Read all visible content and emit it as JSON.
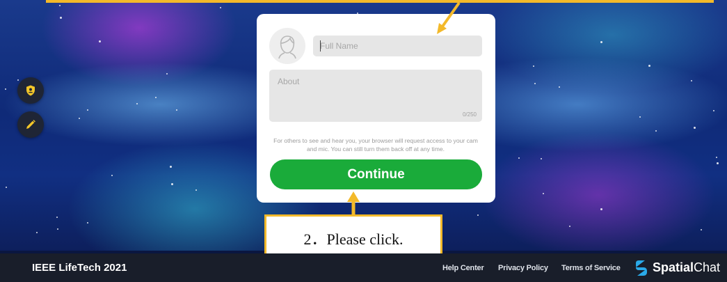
{
  "profile_form": {
    "name_placeholder": "Full Name",
    "about_placeholder": "About",
    "char_count": "0/250",
    "permission_notice": "For others to see and hear you, your browser will request access to your cam and mic. You can still turn them back off at any time.",
    "continue_label": "Continue"
  },
  "sidebar": {
    "items": [
      {
        "icon": "shield-user-icon"
      },
      {
        "icon": "pencil-icon"
      }
    ]
  },
  "annotation": {
    "callout_text": "2．Please click.",
    "accent_color": "#f3b92a"
  },
  "footer": {
    "event_name": "IEEE LifeTech 2021",
    "links": [
      "Help Center",
      "Privacy Policy",
      "Terms of Service"
    ],
    "brand_bold": "Spatial",
    "brand_light": "Chat"
  },
  "colors": {
    "continue_button": "#1aab3a",
    "footer_bg": "#191e2a",
    "icon_yellow": "#f3c629"
  }
}
